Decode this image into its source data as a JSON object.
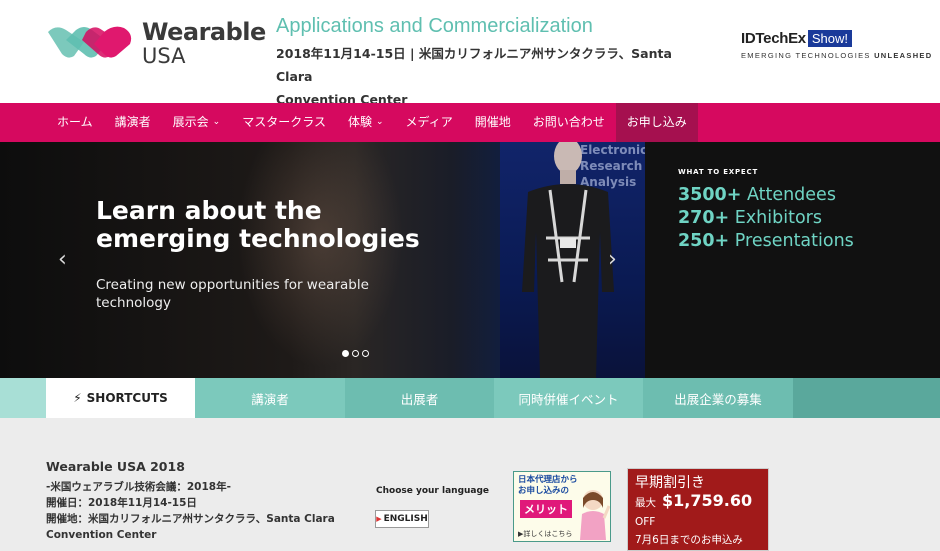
{
  "colors": {
    "brand_magenta": "#d6095f",
    "nav_active": "#a5104f",
    "teal": "#5fbfb0",
    "stat_teal": "#6fd4c4",
    "early_red": "#a11a1a"
  },
  "header": {
    "logo_line1": "Wearable",
    "logo_line2": "USA",
    "event_title": "Applications and Commercialization",
    "event_date_line1": "2018年11月14-15日 | 米国カリフォルニア州サンタクララ、Santa Clara",
    "event_date_line2": "Convention Center",
    "partner_name": "IDTechEx",
    "partner_show": "Show!",
    "partner_tag_light": "EMERGING TECHNOLOGIES ",
    "partner_tag_bold": "UNLEASHED"
  },
  "nav": {
    "items": [
      {
        "label": "ホーム",
        "dropdown": false
      },
      {
        "label": "講演者",
        "dropdown": false
      },
      {
        "label": "展示会",
        "dropdown": true
      },
      {
        "label": "マスタークラス",
        "dropdown": false
      },
      {
        "label": "体験",
        "dropdown": true
      },
      {
        "label": "メディア",
        "dropdown": false
      },
      {
        "label": "開催地",
        "dropdown": false
      },
      {
        "label": "お問い合わせ",
        "dropdown": false
      },
      {
        "label": "お申し込み",
        "dropdown": false,
        "active": true
      }
    ],
    "caret": "⌄"
  },
  "hero": {
    "headline": "Learn about the emerging technologies",
    "subtext": "Creating new opportunities for wearable technology",
    "panel_text": "Electronics\nResearch &\nAnalysis",
    "expect_label": "WHAT TO EXPECT",
    "stats": [
      {
        "number": "3500+",
        "label": " Attendees"
      },
      {
        "number": "270+",
        "label": " Exhibitors"
      },
      {
        "number": "250+",
        "label": " Presentations"
      }
    ],
    "prev_arrow": "‹",
    "next_arrow": "›",
    "slides": 3,
    "current_slide": 1
  },
  "shortcuts": {
    "active_icon": "⚡",
    "active_label": "SHORTCUTS",
    "items": [
      "講演者",
      "出展者",
      "同時併催イベント",
      "出展企業の募集"
    ]
  },
  "info": {
    "title": "Wearable USA 2018",
    "line1": "-米国ウェアラブル技術会議：2018年-",
    "line2": "開催日：2018年11月14-15日",
    "line3": "開催地：米国カリフォルニア州サンタクララ、Santa Clara Convention Center",
    "lang_label": "Choose your language",
    "lang_button": "ENGLISH",
    "lang_flag": "▶"
  },
  "merit_banner": {
    "line1": "日本代理店から",
    "line2": "お申し込みの",
    "badge": "メリット",
    "link": "▶詳しくはこちら"
  },
  "early_bird": {
    "title": "早期割引き",
    "max_label": "最大",
    "price": "$1,759.60",
    "off": "OFF",
    "deadline": "7月6日までのお申込み"
  }
}
